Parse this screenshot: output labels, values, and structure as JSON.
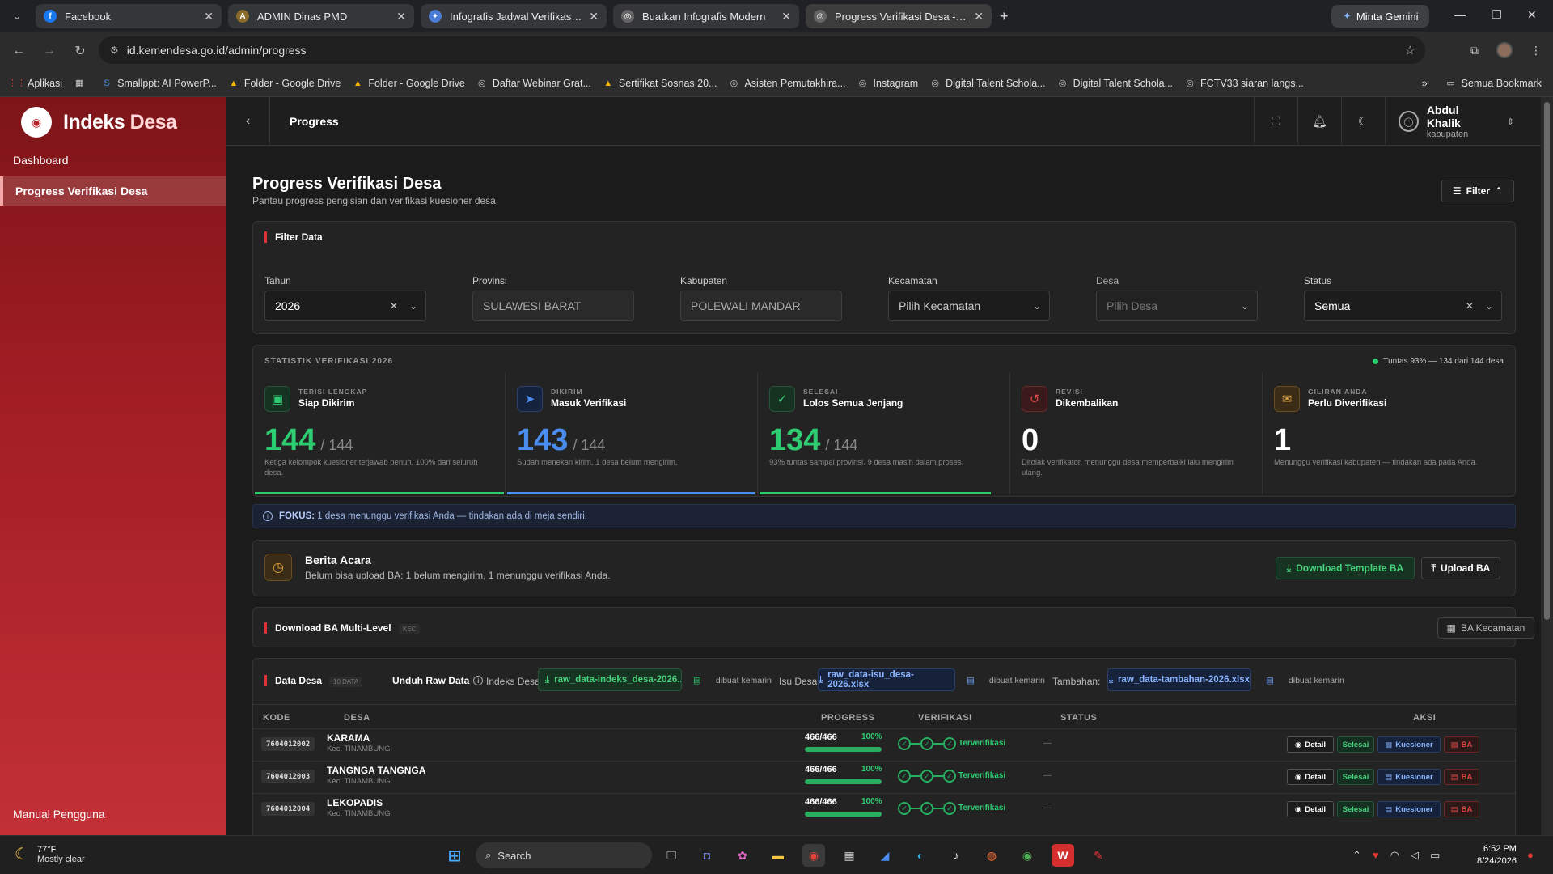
{
  "browser": {
    "tabs": [
      {
        "title": "Facebook",
        "color": "#1877f2",
        "glyph": "f"
      },
      {
        "title": "ADMIN Dinas PMD",
        "color": "#8b6b2a",
        "glyph": "A"
      },
      {
        "title": "Infografis Jadwal Verifikasi Ijazah",
        "color": "#4a7bd4",
        "glyph": "✦"
      },
      {
        "title": "Buatkan Infografis Modern",
        "color": "#666",
        "glyph": "◎"
      },
      {
        "title": "Progress Verifikasi Desa - Indeks",
        "color": "#666",
        "glyph": "◎"
      }
    ],
    "gemini_label": "Minta Gemini",
    "url": "id.kemendesa.go.id/admin/progress",
    "bookmarks": [
      {
        "label": "Aplikasi",
        "icon": "grid-icon"
      },
      {
        "label": "",
        "icon": "apps-icon"
      },
      {
        "label": "Smallppt: AI PowerP...",
        "icon": "s-icon"
      },
      {
        "label": "Folder - Google Drive",
        "icon": "drive-icon"
      },
      {
        "label": "Folder - Google Drive",
        "icon": "drive-icon"
      },
      {
        "label": "Daftar Webinar Grat...",
        "icon": "globe-icon"
      },
      {
        "label": "Sertifikat Sosnas 20...",
        "icon": "drive-icon"
      },
      {
        "label": "Asisten Pemutakhira...",
        "icon": "globe-icon"
      },
      {
        "label": "Instagram",
        "icon": "globe-icon"
      },
      {
        "label": "Digital Talent Schola...",
        "icon": "globe-icon"
      },
      {
        "label": "Digital Talent Schola...",
        "icon": "globe-icon"
      },
      {
        "label": "FCTV33 siaran langs...",
        "icon": "globe-icon"
      }
    ],
    "all_bookmarks": "Semua Bookmark"
  },
  "sidebar": {
    "brand_a": "Indeks",
    "brand_b": "Desa",
    "items": [
      {
        "label": "Dashboard"
      },
      {
        "label": "Progress Verifikasi Desa"
      }
    ],
    "footer": "Manual Pengguna"
  },
  "topbar": {
    "title": "Progress",
    "user_name": "Abdul Khalik",
    "user_role": "kabupaten"
  },
  "page": {
    "title": "Progress Verifikasi Desa",
    "subtitle": "Pantau progress pengisian dan verifikasi kuesioner desa",
    "filter_button": "Filter"
  },
  "filter": {
    "heading": "Filter Data",
    "fields": [
      {
        "label": "Tahun",
        "value": "2026"
      },
      {
        "label": "Provinsi",
        "value": "SULAWESI BARAT"
      },
      {
        "label": "Kabupaten",
        "value": "POLEWALI MANDAR"
      },
      {
        "label": "Kecamatan",
        "value": "Pilih Kecamatan"
      },
      {
        "label": "Desa",
        "value": "Pilih Desa"
      },
      {
        "label": "Status",
        "value": "Semua"
      }
    ]
  },
  "stats": {
    "heading": "STATISTIK VERIFIKASI 2026",
    "summary": "Tuntas 93% — 134 dari 144 desa",
    "cards": [
      {
        "caption": "TERISI LENGKAP",
        "title": "Siap Dikirim",
        "value": "144",
        "total": "/ 144",
        "desc": "Ketiga kelompok kuesioner terjawab penuh. 100% dari seluruh desa.",
        "color": "#2ecc71",
        "icon": "clipboard-icon",
        "fill": 1.0
      },
      {
        "caption": "DIKIRIM",
        "title": "Masuk Verifikasi",
        "value": "143",
        "total": "/ 144",
        "desc": "Sudah menekan kirim. 1 desa belum mengirim.",
        "color": "#4a8df0",
        "icon": "send-icon",
        "fill": 0.993
      },
      {
        "caption": "SELESAI",
        "title": "Lolos Semua Jenjang",
        "value": "134",
        "total": "/ 144",
        "desc": "93% tuntas sampai provinsi. 9 desa masih dalam proses.",
        "color": "#2ecc71",
        "icon": "check-circle-icon",
        "fill": 0.93
      },
      {
        "caption": "REVISI",
        "title": "Dikembalikan",
        "value": "0",
        "total": "",
        "desc": "Ditolak verifikator, menunggu desa memperbaiki lalu mengirim ulang.",
        "color": "#ffffff",
        "icon": "undo-icon",
        "fill": 0
      },
      {
        "caption": "GILIRAN ANDA",
        "title": "Perlu Diverifikasi",
        "value": "1",
        "total": "",
        "desc": "Menunggu verifikasi kabupaten — tindakan ada pada Anda.",
        "color": "#ffffff",
        "icon": "inbox-icon",
        "fill": 0
      }
    ]
  },
  "focus": {
    "label": "FOKUS:",
    "text": "1 desa menunggu verifikasi Anda — tindakan ada di meja sendiri."
  },
  "berita_acara": {
    "title": "Berita Acara",
    "desc": "Belum bisa upload BA: 1 belum mengirim, 1 menunggu verifikasi Anda.",
    "download_btn": "Download Template BA",
    "upload_btn": "Upload BA"
  },
  "multilevel": {
    "title": "Download BA Multi-Level",
    "tag": "KEC",
    "button": "BA Kecamatan"
  },
  "data_desa": {
    "title": "Data Desa",
    "count": "10 DATA",
    "raw_label": "Unduh Raw Data",
    "indeks_label": "Indeks Desa:",
    "indeks_file": "raw_data-indeks_desa-2026....",
    "isu_label": "Isu Desa:",
    "isu_file": "raw_data-isu_desa-2026.xlsx",
    "tambahan_label": "Tambahan:",
    "tambahan_file": "raw_data-tambahan-2026.xlsx",
    "created": "dibuat kemarin",
    "columns": [
      "KODE",
      "DESA",
      "PROGRESS",
      "VERIFIKASI",
      "STATUS",
      "AKSI"
    ],
    "rows": [
      {
        "kode": "7604012002",
        "desa": "KARAMA",
        "kec": "Kec. TINAMBUNG",
        "progress": "466/466",
        "pct": "100%",
        "fill": 1.0,
        "verif": "Terverifikasi",
        "status": "—"
      },
      {
        "kode": "7604012003",
        "desa": "TANGNGA TANGNGA",
        "kec": "Kec. TINAMBUNG",
        "progress": "466/466",
        "pct": "100%",
        "fill": 1.0,
        "verif": "Terverifikasi",
        "status": "—"
      },
      {
        "kode": "7604012004",
        "desa": "LEKOPADIS",
        "kec": "Kec. TINAMBUNG",
        "progress": "466/466",
        "pct": "100%",
        "fill": 1.0,
        "verif": "Terverifikasi",
        "status": "—"
      }
    ],
    "actions": {
      "detail": "Detail",
      "selesai": "Selesai",
      "kuesioner": "Kuesioner",
      "ba": "BA"
    }
  },
  "taskbar": {
    "temp": "77°F",
    "weather": "Mostly clear",
    "search": "Search",
    "time": "6:52 PM",
    "date": "8/24/2026"
  }
}
